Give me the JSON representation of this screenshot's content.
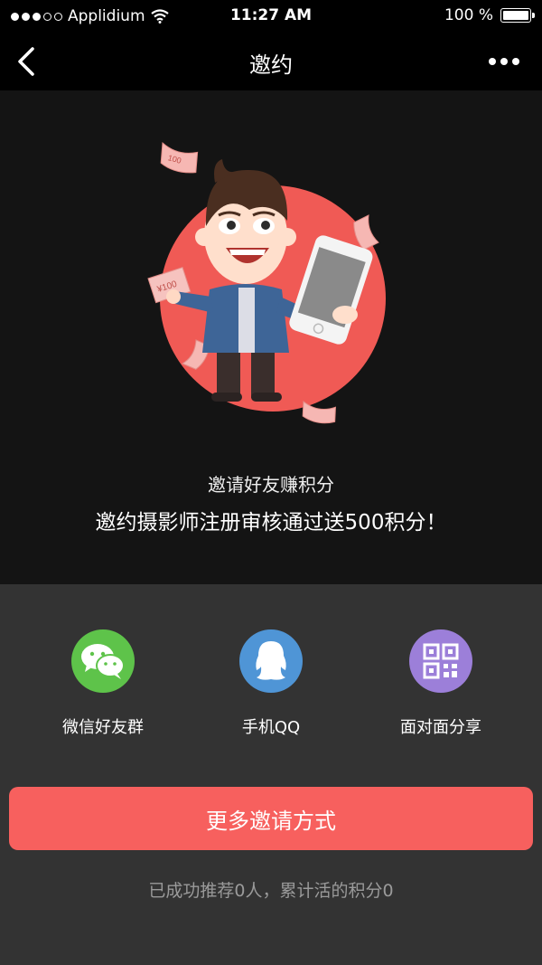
{
  "status_bar": {
    "carrier": "Applidium",
    "time": "11:27 AM",
    "battery": "100 %"
  },
  "nav": {
    "title": "邀约"
  },
  "hero": {
    "bill_label": "¥100",
    "bill_small": "100",
    "subtitle": "邀请好友赚积分",
    "headline": "邀约摄影师注册审核通过送500积分！"
  },
  "share": {
    "items": [
      {
        "label": "微信好友群",
        "icon": "wechat-icon",
        "color": "#5ec34a"
      },
      {
        "label": "手机QQ",
        "icon": "qq-icon",
        "color": "#4f95d6"
      },
      {
        "label": "面对面分享",
        "icon": "qr-code-icon",
        "color": "#9c7fd9"
      }
    ]
  },
  "more_button": {
    "label": "更多邀请方式",
    "color": "#f7605e"
  },
  "stats": {
    "text": "已成功推荐0人，累计活的积分0"
  }
}
